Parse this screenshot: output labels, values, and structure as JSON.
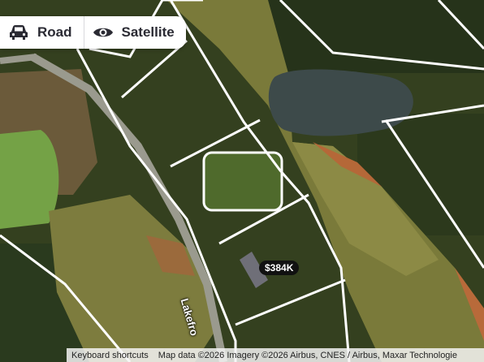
{
  "map_type": {
    "road_label": "Road",
    "satellite_label": "Satellite",
    "road_icon": "car-icon",
    "satellite_icon": "eye-icon"
  },
  "listing": {
    "price": "$384K"
  },
  "labels": {
    "street_partial": "Lakefro"
  },
  "footer": {
    "shortcuts": "Keyboard shortcuts",
    "attribution": "Map data ©2026 Imagery ©2026 Airbus, CNES / Airbus, Maxar Technologie"
  },
  "colors": {
    "parcel_line": "#ffffff",
    "price_badge": "#111111"
  }
}
